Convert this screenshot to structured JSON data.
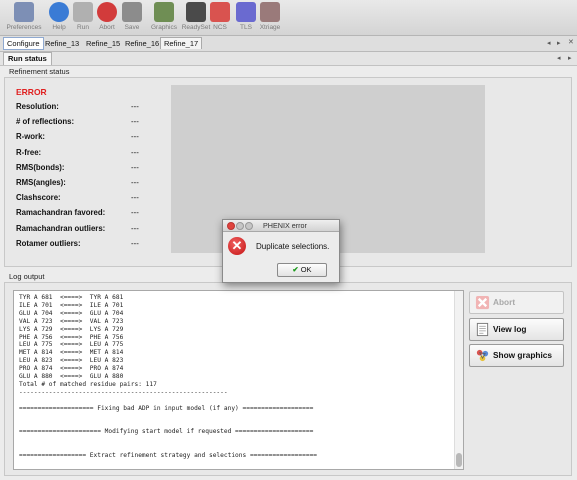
{
  "toolbar": {
    "items": [
      {
        "label": "Preferences",
        "icon": "preferences-icon",
        "color": "#7d8fb5"
      },
      {
        "label": "Help",
        "icon": "help-icon",
        "color": "#3a7bd5"
      },
      {
        "label": "Run",
        "icon": "run-icon",
        "color": "#b0b0b0"
      },
      {
        "label": "Abort",
        "icon": "abort-icon",
        "color": "#d23b3b"
      },
      {
        "label": "Save",
        "icon": "save-icon",
        "color": "#8c8c8c"
      },
      {
        "label": "Graphics",
        "icon": "graphics-icon",
        "color": "#6f8e54"
      },
      {
        "label": "ReadySet",
        "icon": "readyset-icon",
        "color": "#4a4a4a"
      },
      {
        "label": "NCS",
        "icon": "ncs-icon",
        "color": "#d9534f"
      },
      {
        "label": "TLS",
        "icon": "tls-icon",
        "color": "#6a6ad0"
      },
      {
        "label": "Xtriage",
        "icon": "xtriage-icon",
        "color": "#9a7a7a"
      }
    ]
  },
  "tabs": [
    "Configure",
    "Refine_13",
    "Refine_15",
    "Refine_16",
    "Refine_17"
  ],
  "subtab": "Run status",
  "refinement": {
    "section_label": "Refinement status",
    "state": "ERROR",
    "stats": [
      {
        "label": "Resolution:",
        "value": "---"
      },
      {
        "label": "# of reflections:",
        "value": "---"
      },
      {
        "label": "R-work:",
        "value": "---"
      },
      {
        "label": "R-free:",
        "value": "---"
      },
      {
        "label": "RMS(bonds):",
        "value": "---"
      },
      {
        "label": "RMS(angles):",
        "value": "---"
      },
      {
        "label": "Clashscore:",
        "value": "---"
      },
      {
        "label": "Ramachandran favored:",
        "value": "---"
      },
      {
        "label": "Ramachandran outliers:",
        "value": "---"
      },
      {
        "label": "Rotamer outliers:",
        "value": "---"
      }
    ]
  },
  "log": {
    "section_label": "Log output",
    "lines": [
      "TYR A 681  <====>  TYR A 681",
      "ILE A 701  <====>  ILE A 701",
      "GLU A 704  <====>  GLU A 704",
      "VAL A 723  <====>  VAL A 723",
      "LYS A 729  <====>  LYS A 729",
      "PHE A 756  <====>  PHE A 756",
      "LEU A 775  <====>  LEU A 775",
      "MET A 814  <====>  MET A 814",
      "LEU A 823  <====>  LEU A 823",
      "PRO A 874  <====>  PRO A 874",
      "GLU A 880  <====>  GLU A 880",
      "Total # of matched residue pairs: 117",
      "--------------------------------------------------------",
      "",
      "==================== Fixing bad ADP in input model (if any) ===================",
      "",
      "",
      "====================== Modifying start model if requested =====================",
      "",
      "",
      "================== Extract refinement strategy and selections =================="
    ]
  },
  "side_buttons": {
    "abort": "Abort",
    "view_log": "View log",
    "show_graphics": "Show graphics"
  },
  "dialog": {
    "title": "PHENIX error",
    "message": "Duplicate selections.",
    "ok": "OK"
  }
}
